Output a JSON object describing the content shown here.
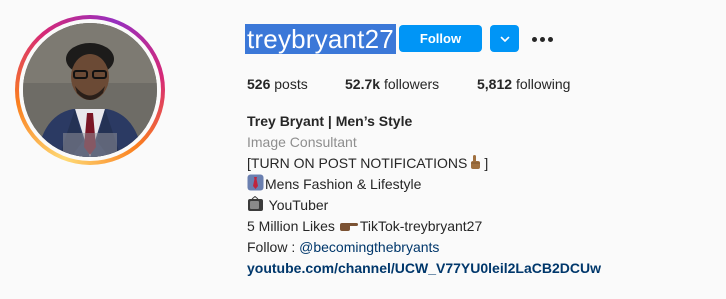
{
  "profile": {
    "username": "treybryant27",
    "follow_label": "Follow",
    "stats": {
      "posts_count": "526",
      "posts_label": "posts",
      "followers_count": "52.7k",
      "followers_label": "followers",
      "following_count": "5,812",
      "following_label": "following"
    },
    "bio": {
      "full_name": "Trey Bryant | Men’s Style",
      "category": "Image Consultant",
      "lines": [
        "[TURN ON POST NOTIFICATIONS",
        "]",
        "Mens Fashion & Lifestyle",
        " YouTuber",
        "5 Million Likes ",
        "TikTok-treybryant27"
      ],
      "follow_prefix": "Follow : ",
      "mention": "@becomingthebryants",
      "link": "youtube.com/channel/UCW_V77YU0leil2LaCB2DCUw"
    }
  },
  "colors": {
    "follow_blue": "#0095f6",
    "selection_blue": "#3b78d8",
    "link_blue": "#00376b",
    "muted_gray": "#8e8e8e"
  },
  "icons": {
    "dropdown": "chevron-down-icon",
    "more": "more-options-icon",
    "emoji_point_right": "pointing-finger-icon",
    "emoji_tie": "necktie-icon",
    "emoji_tv": "television-icon",
    "emoji_point_hand": "pointing-hand-icon"
  }
}
